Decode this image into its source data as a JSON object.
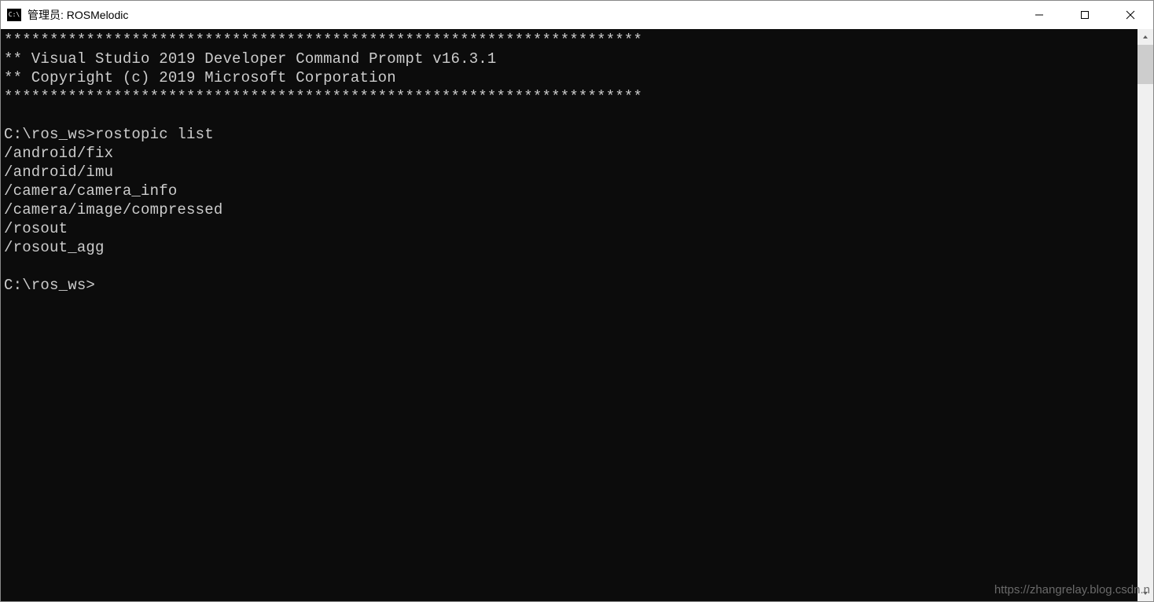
{
  "titlebar": {
    "icon_glyph": "C:\\",
    "title": "管理员: ROSMelodic"
  },
  "window_controls": {
    "minimize": "minimize",
    "maximize": "maximize",
    "close": "close"
  },
  "terminal": {
    "border_line": "**********************************************************************",
    "header1": "** Visual Studio 2019 Developer Command Prompt v16.3.1",
    "header2": "** Copyright (c) 2019 Microsoft Corporation",
    "prompt1_path": "C:\\ros_ws>",
    "command1": "rostopic list",
    "output_lines": [
      "/android/fix",
      "/android/imu",
      "/camera/camera_info",
      "/camera/image/compressed",
      "/rosout",
      "/rosout_agg"
    ],
    "prompt2_path": "C:\\ros_ws>"
  },
  "watermark": "https://zhangrelay.blog.csdn.n"
}
